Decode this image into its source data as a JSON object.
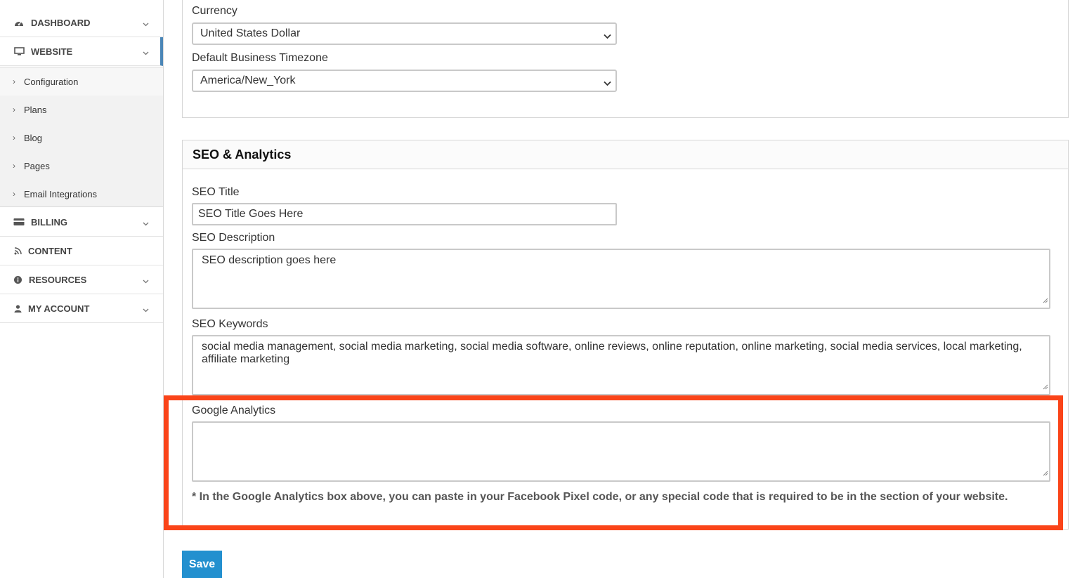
{
  "sidebar": {
    "items": [
      {
        "label": "DASHBOARD",
        "icon": "dashboard-icon"
      },
      {
        "label": "WEBSITE",
        "icon": "monitor-icon"
      },
      {
        "label": "BILLING",
        "icon": "credit-card-icon"
      },
      {
        "label": "CONTENT",
        "icon": "rss-icon"
      },
      {
        "label": "RESOURCES",
        "icon": "info-icon"
      },
      {
        "label": "MY ACCOUNT",
        "icon": "user-icon"
      }
    ],
    "website_submenu": [
      "Configuration",
      "Plans",
      "Blog",
      "Pages",
      "Email Integrations"
    ]
  },
  "settings": {
    "currency_label": "Currency",
    "currency_value": "United States Dollar",
    "timezone_label": "Default Business Timezone",
    "timezone_value": "America/New_York"
  },
  "seo": {
    "heading": "SEO & Analytics",
    "title_label": "SEO Title",
    "title_value": "SEO Title Goes Here",
    "description_label": "SEO Description",
    "description_value": "SEO description goes here",
    "keywords_label": "SEO Keywords",
    "keywords_value": "social media management, social media marketing, social media software, online reviews, online reputation, online marketing, social media services, local marketing, affiliate marketing",
    "analytics_label": "Google Analytics",
    "analytics_value": "",
    "analytics_note": "* In the Google Analytics box above, you can paste in your Facebook Pixel code, or any special code that is required to be in the section of your website."
  },
  "actions": {
    "save_label": "Save"
  },
  "colors": {
    "accent": "#2390cf",
    "highlight": "#fa4419",
    "active_bar": "#4b86b7"
  }
}
